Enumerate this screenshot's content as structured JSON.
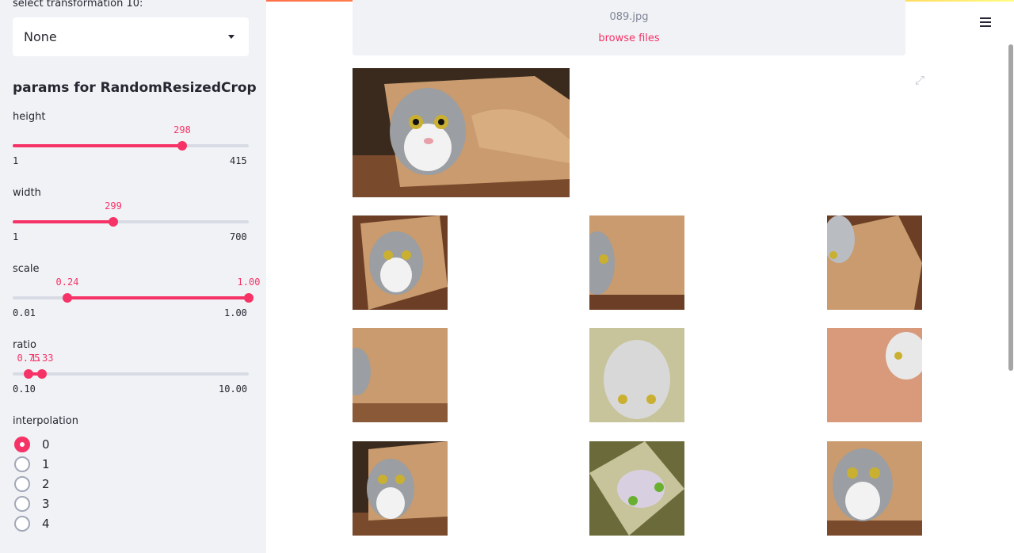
{
  "sidebar": {
    "select_label": "select transformation 10:",
    "select_value": "None",
    "section_title": "params for RandomResizedCrop",
    "height": {
      "label": "height",
      "value": "298",
      "min": "1",
      "max": "415",
      "fraction": 0.7167
    },
    "width": {
      "label": "width",
      "value": "299",
      "min": "1",
      "max": "700",
      "fraction": 0.4263
    },
    "scale": {
      "label": "scale",
      "low": "0.24",
      "high": "1.00",
      "min": "0.01",
      "max": "1.00",
      "low_fraction": 0.2323,
      "high_fraction": 1.0
    },
    "ratio": {
      "label": "ratio",
      "low": "0.75",
      "high": "1.33",
      "min": "0.10",
      "max": "10.00",
      "low_fraction": 0.0657,
      "high_fraction": 0.1242
    },
    "interpolation": {
      "label": "interpolation",
      "options": [
        "0",
        "1",
        "2",
        "3",
        "4"
      ],
      "selected": "0"
    }
  },
  "uploader": {
    "file_name": "089.jpg",
    "browse_label": "browse files"
  },
  "colors": {
    "accent": "#f63366",
    "sidebar_bg": "#f0f2f6"
  },
  "icons": {
    "menu": "hamburger-menu-icon",
    "expand": "fullscreen-expand-icon"
  }
}
